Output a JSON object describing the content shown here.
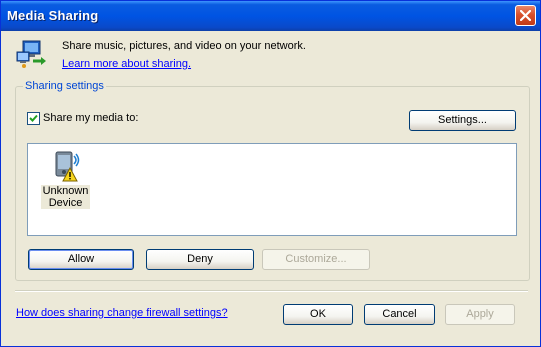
{
  "window": {
    "title": "Media Sharing",
    "close_icon": "close-icon"
  },
  "header": {
    "icon": "network-sharing-icon",
    "description": "Share music, pictures, and video on your network.",
    "learn_more_link": "Learn more about sharing."
  },
  "sharing_settings": {
    "group_label": "Sharing settings",
    "share_checkbox": {
      "label": "Share my media to:",
      "checked": true
    },
    "settings_button": "Settings...",
    "devices": [
      {
        "name_line1": "Unknown",
        "name_line2": "Device",
        "icon": "unknown-device-warning-icon",
        "selected": true
      }
    ],
    "allow_button": "Allow",
    "deny_button": "Deny",
    "customize_button": "Customize..."
  },
  "footer": {
    "firewall_link": "How does sharing change firewall settings?",
    "ok_button": "OK",
    "cancel_button": "Cancel",
    "apply_button": "Apply"
  }
}
